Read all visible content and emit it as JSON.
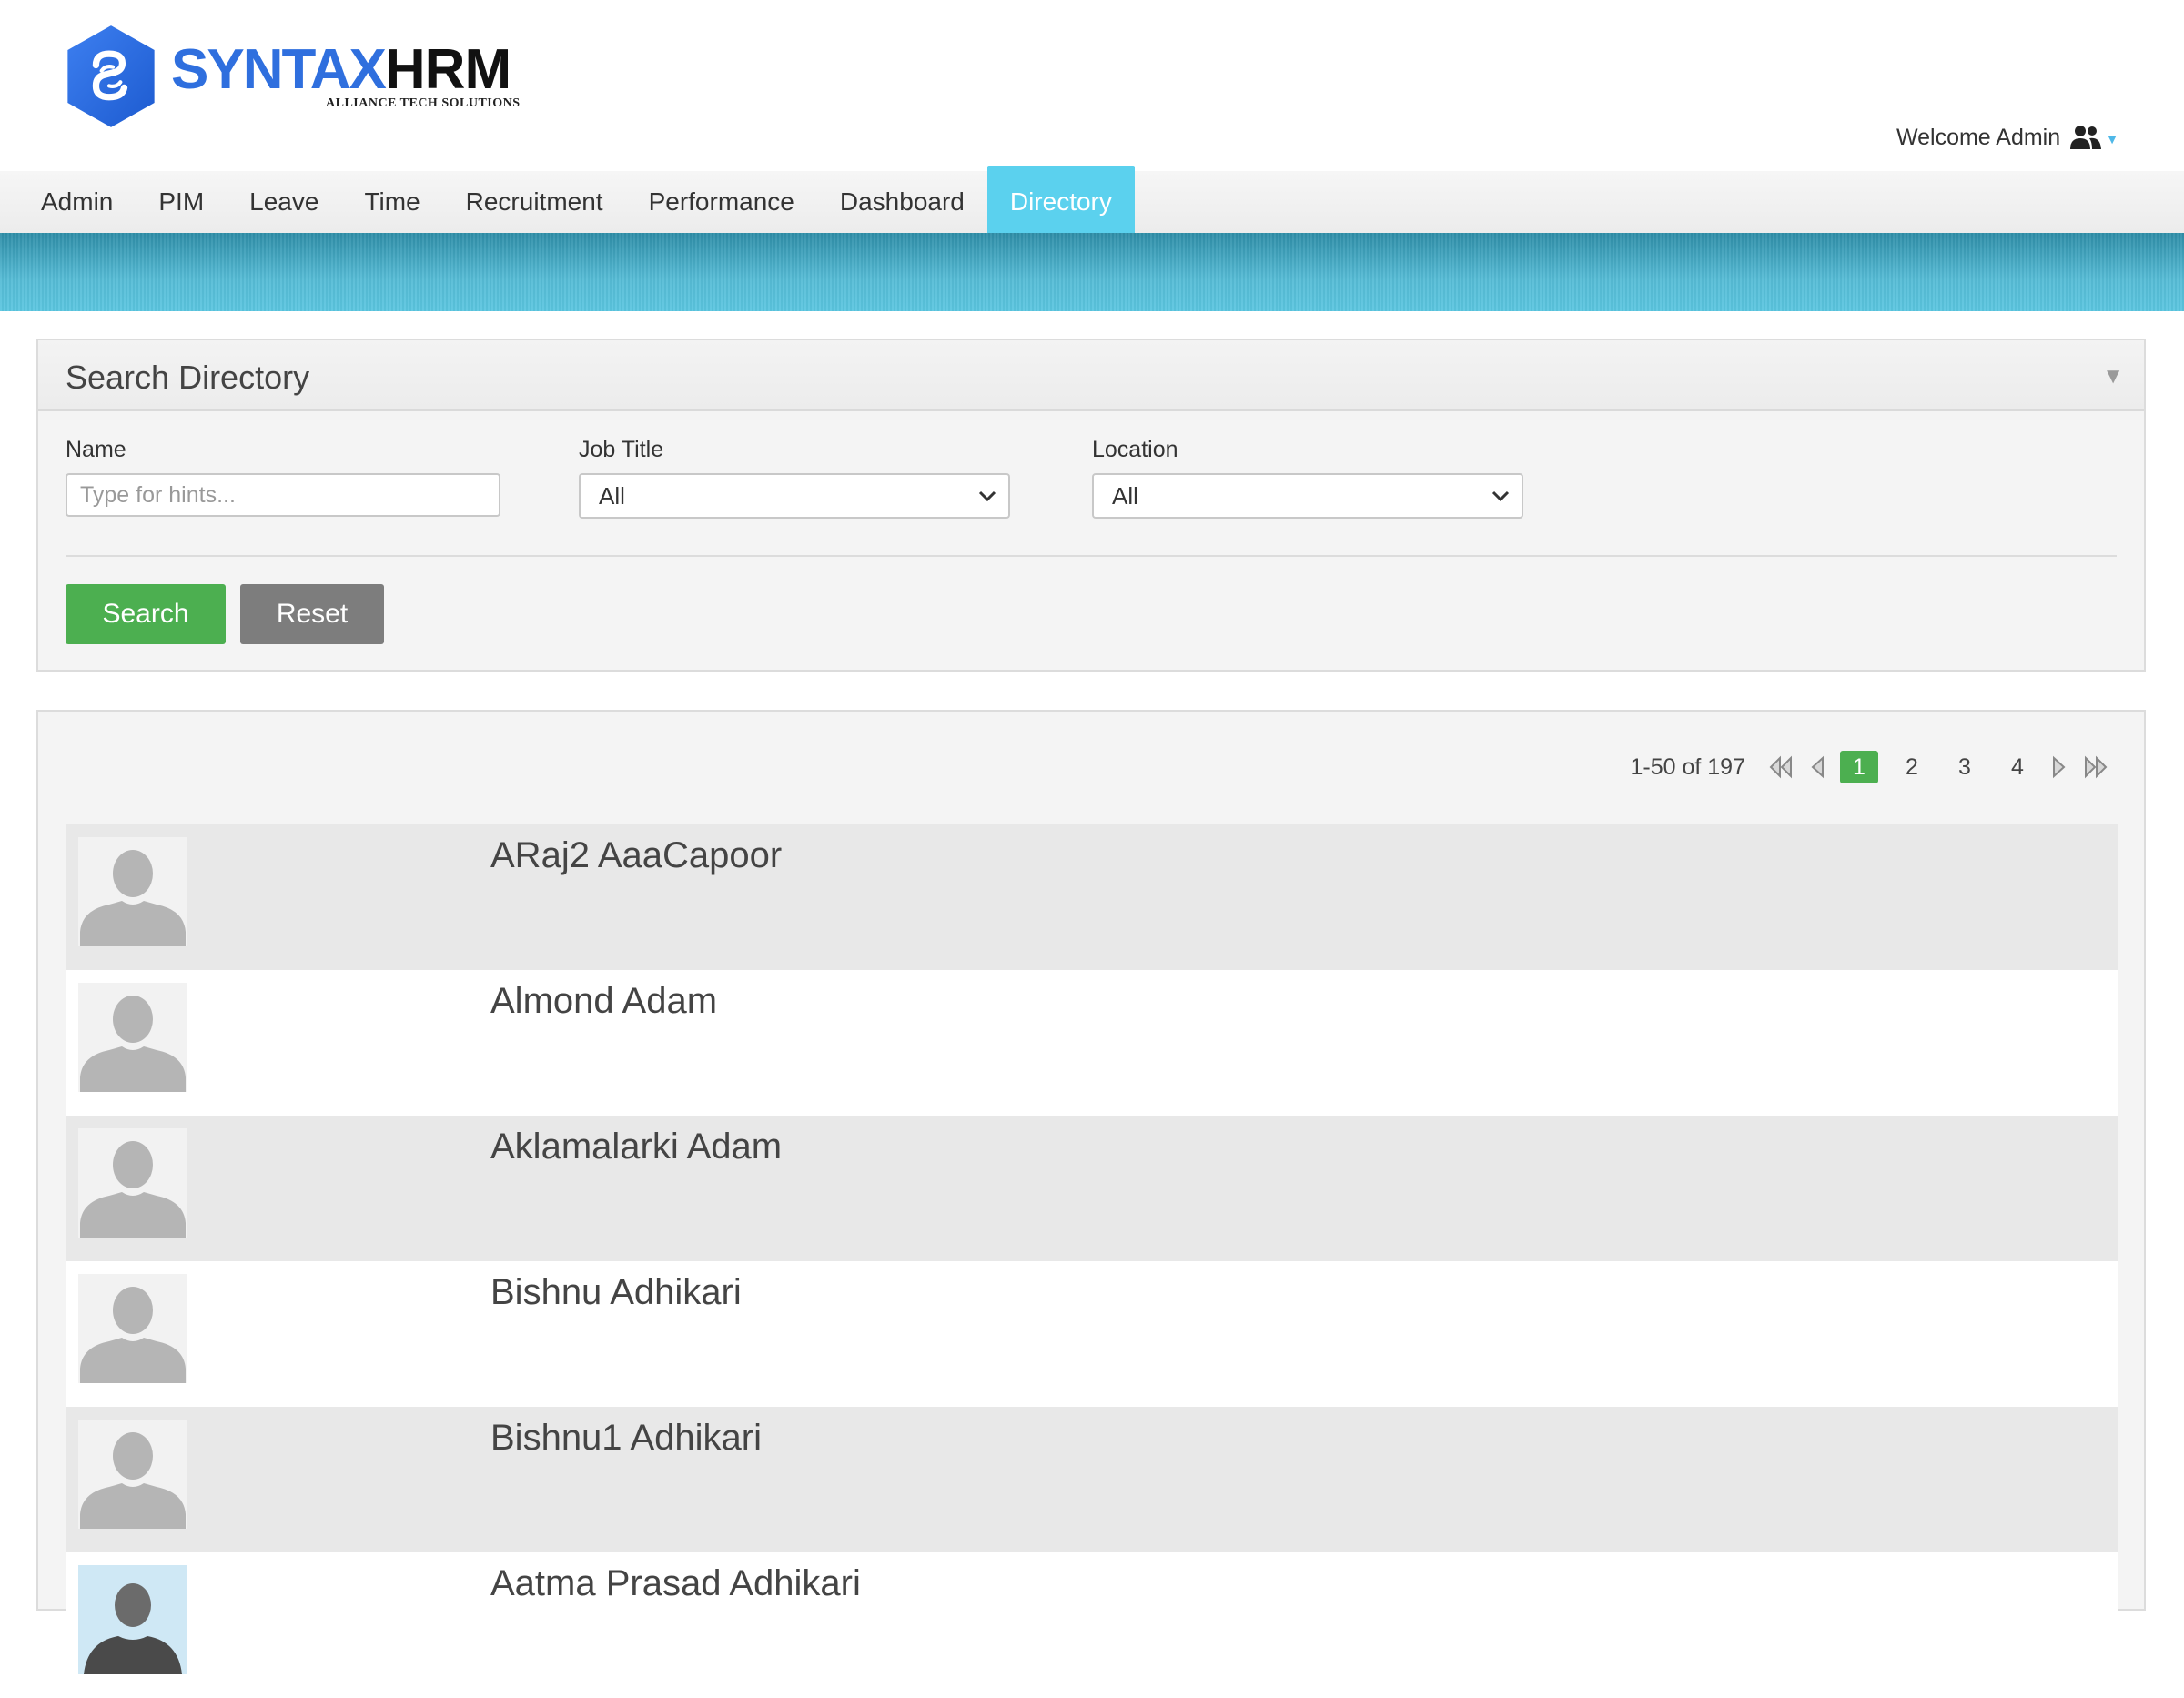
{
  "brand": {
    "name_part1": "SYNTAX",
    "name_part2": "HRM",
    "tagline": "ALLIANCE TECH SOLUTIONS",
    "primary_color": "#2f6fde"
  },
  "user": {
    "welcome_text": "Welcome Admin",
    "icon": "users-icon"
  },
  "menu": {
    "items": [
      "Admin",
      "PIM",
      "Leave",
      "Time",
      "Recruitment",
      "Performance",
      "Dashboard",
      "Directory"
    ],
    "active": "Directory",
    "active_color": "#5bd1ee"
  },
  "search": {
    "title": "Search Directory",
    "name_label": "Name",
    "name_placeholder": "Type for hints...",
    "job_title_label": "Job Title",
    "job_title_value": "All",
    "location_label": "Location",
    "location_value": "All",
    "search_button": "Search",
    "reset_button": "Reset",
    "search_color": "#4caf50",
    "reset_color": "#7d7d7d"
  },
  "pagination": {
    "summary": "1-50 of 197",
    "pages": [
      "1",
      "2",
      "3",
      "4"
    ],
    "current": "1"
  },
  "employees": [
    {
      "name": "ARaj2 AaaCapoor"
    },
    {
      "name": "Almond Adam"
    },
    {
      "name": "Aklamalarki Adam"
    },
    {
      "name": "Bishnu Adhikari"
    },
    {
      "name": "Bishnu1 Adhikari"
    },
    {
      "name": "Aatma Prasad Adhikari"
    }
  ]
}
